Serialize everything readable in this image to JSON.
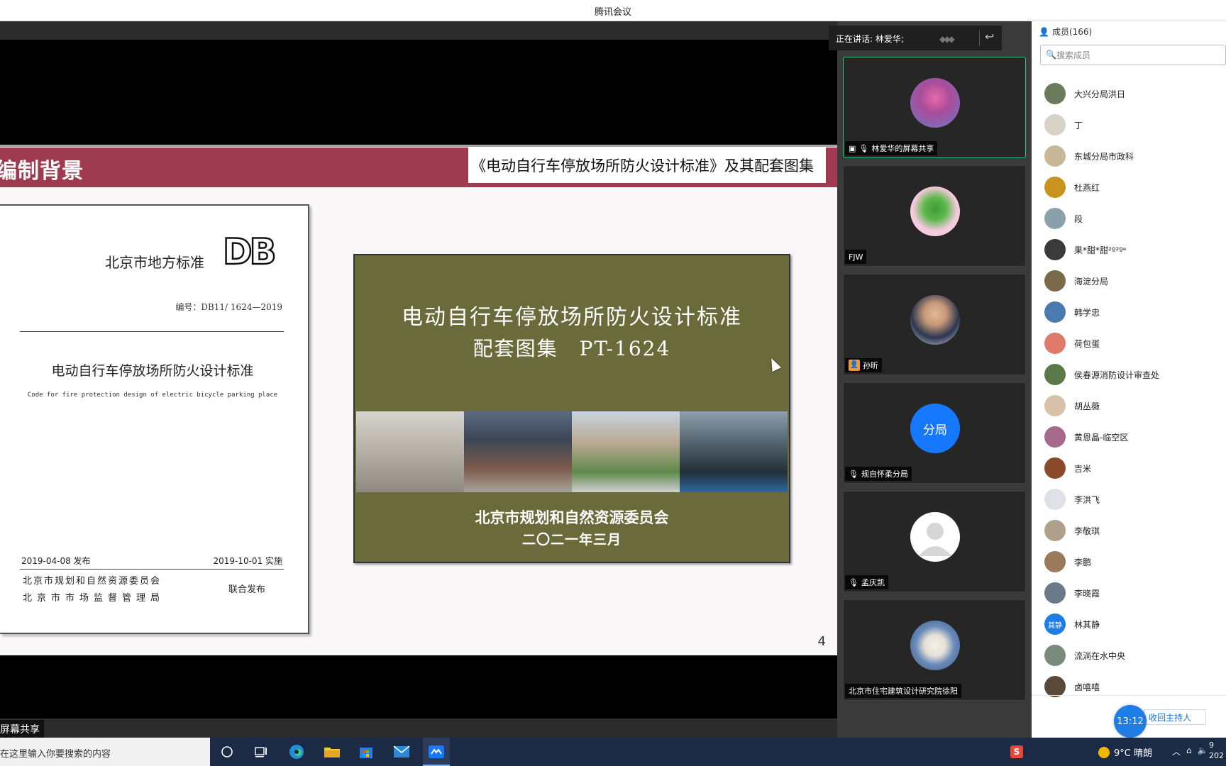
{
  "window": {
    "title": "腾讯会议"
  },
  "share": {
    "label": "屏幕共享",
    "slide": {
      "section_tab": "编制背景",
      "subtitle": "《电动自行车停放场所防火设计标准》及其配套图集",
      "page_number": "4",
      "doc": {
        "std_label": "北京市地方标准",
        "logo": "DB",
        "code": "编号：DB11/ 1624—2019",
        "title_cn": "电动自行车停放场所防火设计标准",
        "title_en": "Code for fire protection design of electric bicycle parking place",
        "release": "2019-04-08 发布",
        "implement": "2019-10-01 实施",
        "org1": "北京市规划和自然资源委员会",
        "org2": "北京市市场监督管理局",
        "joint": "联合发布"
      },
      "atlas": {
        "title1": "电动自行车停放场所防火设计标准",
        "title2": "配套图集　PT-1624",
        "org": "北京市规划和自然资源委员会",
        "date": "二〇二一年三月"
      }
    }
  },
  "speaking": {
    "text": "正在讲话: 林爱华;"
  },
  "video_tiles": [
    {
      "name": "林爱华的屏幕共享",
      "active": true
    },
    {
      "name": "FJW",
      "active": false
    },
    {
      "name": "孙昕",
      "active": false
    },
    {
      "name": "规自怀柔分局",
      "avatar_text": "分局",
      "active": false
    },
    {
      "name": "孟庆凯",
      "active": false
    },
    {
      "name": "北京市住宅建筑设计研究院徐阳",
      "active": false
    }
  ],
  "members": {
    "header": "成员(166)",
    "search_placeholder": "搜索成员",
    "list": [
      {
        "name": "大兴分局洪日",
        "color": "#6b7a5a"
      },
      {
        "name": "丁",
        "color": "#d8d2c6"
      },
      {
        "name": "东城分局市政科",
        "color": "#c9b79a"
      },
      {
        "name": "杜燕红",
        "color": "#c8941e"
      },
      {
        "name": "段",
        "color": "#8aa0aa"
      },
      {
        "name": "果*甜*甜²º²ºᵉ",
        "color": "#3a3a3a"
      },
      {
        "name": "海淀分局",
        "color": "#7a6a4a"
      },
      {
        "name": "韩学忠",
        "color": "#4a7ab0"
      },
      {
        "name": "荷包蛋",
        "color": "#e07a6a"
      },
      {
        "name": "侯春源消防设计审查处",
        "color": "#5a7a4a"
      },
      {
        "name": "胡丛薇",
        "color": "#d9c2aa"
      },
      {
        "name": "黄恩晶-临空区",
        "color": "#a66a8a"
      },
      {
        "name": "吉米",
        "color": "#8a4a2a"
      },
      {
        "name": "李洪飞",
        "color": "#e0e0e8"
      },
      {
        "name": "李敬琪",
        "color": "#b0a08a"
      },
      {
        "name": "李鹏",
        "color": "#9a7a5a"
      },
      {
        "name": "李晓霞",
        "color": "#6a7a8a"
      },
      {
        "name": "林其静",
        "color": "#1f7ee6",
        "avatar_text": "其静"
      },
      {
        "name": "流淌在水中央",
        "color": "#7a8a7a"
      },
      {
        "name": "卤嘻嘻",
        "color": "#5a4a3a"
      }
    ],
    "reclaim_host": "收回主持人"
  },
  "meeting_timer": "13:12",
  "taskbar": {
    "search_text": "在这里输入你要搜索的内容",
    "weather": "9°C  晴朗",
    "clock_line1": "9",
    "clock_line2": "202"
  }
}
